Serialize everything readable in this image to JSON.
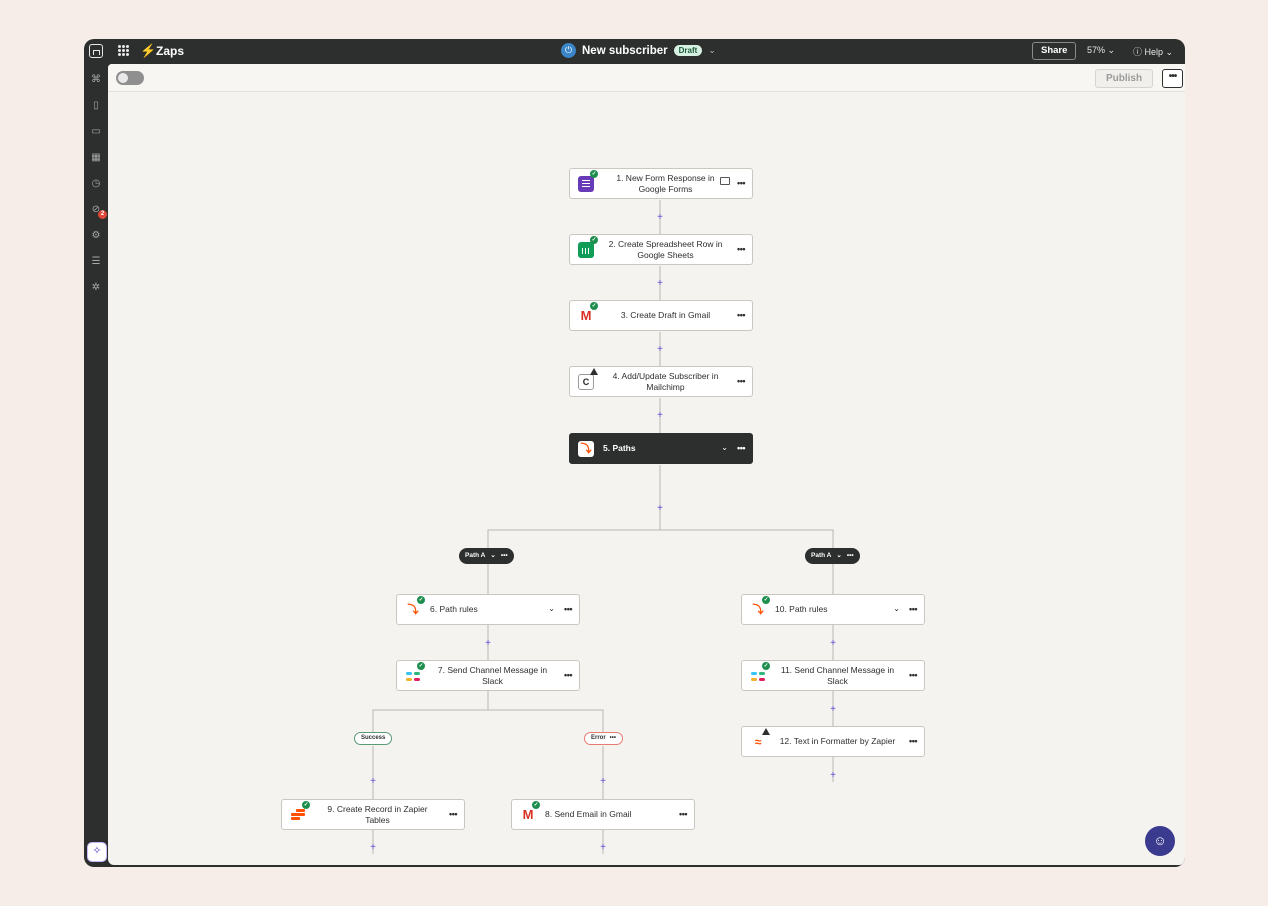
{
  "topbar": {
    "app_title": "Zaps",
    "zap_name": "New subscriber",
    "status_badge": "Draft",
    "share_label": "Share",
    "zoom_label": "57% ⌄",
    "help_label": "ⓘ Help ⌄"
  },
  "toolbar": {
    "publish_label": "Publish",
    "more_label": "•••"
  },
  "steps": {
    "s1": "1. New Form Response in Google Forms",
    "s2": "2. Create Spreadsheet Row in Google Sheets",
    "s3": "3. Create Draft in Gmail",
    "s4": "4. Add/Update Subscriber in Mailchimp",
    "s5": "5. Paths",
    "s6": "6. Path rules",
    "s7": "7. Send Channel Message in Slack",
    "s8": "8. Send Email in Gmail",
    "s9": "9. Create Record in Zapier Tables",
    "s10": "10. Path rules",
    "s11": "11. Send Channel Message in Slack",
    "s12": "12. Text in Formatter by Zapier"
  },
  "paths": {
    "left": "Path A",
    "right": "Path A"
  },
  "branches": {
    "success": "Success",
    "error": "Error"
  },
  "step_menu": "•••",
  "plus": "+",
  "colors": {
    "accent": "#ff4f00",
    "success": "#1d8e4d",
    "chrome": "#2d2e2e",
    "canvas": "#f4f3ef"
  }
}
